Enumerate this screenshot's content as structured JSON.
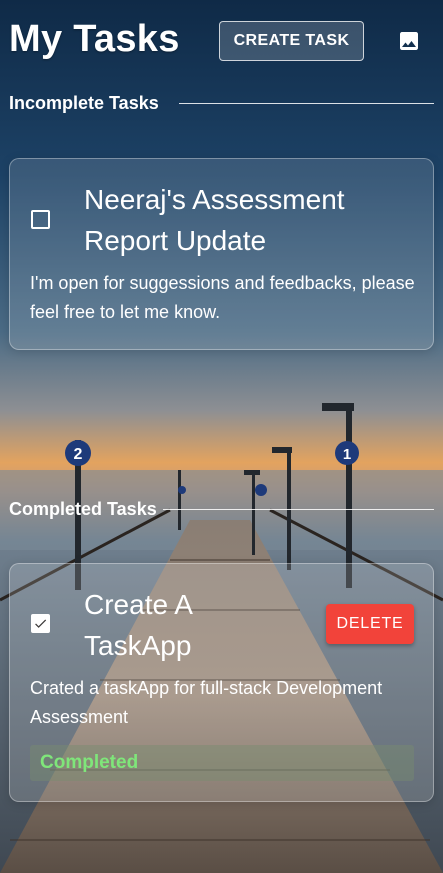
{
  "header": {
    "title": "My Tasks",
    "create_button": "CREATE TASK",
    "image_icon": "image-icon"
  },
  "sections": {
    "incomplete": "Incomplete Tasks",
    "completed": "Completed Tasks"
  },
  "incomplete_tasks": [
    {
      "title": "Neeraj's Assessment Report Update",
      "description": "I'm open for suggessions and feedbacks, please feel free to let me know.",
      "checked": false
    }
  ],
  "completed_tasks": [
    {
      "title": "Create A TaskApp",
      "description": "Crated a taskApp for full-stack Development Assessment",
      "checked": true,
      "delete_label": "DELETE",
      "status": "Completed"
    }
  ],
  "colors": {
    "delete": "#f2433a",
    "completed_text": "#7fe67a",
    "sky_top": "#0f2a47",
    "sunset": "#e6a05a"
  }
}
